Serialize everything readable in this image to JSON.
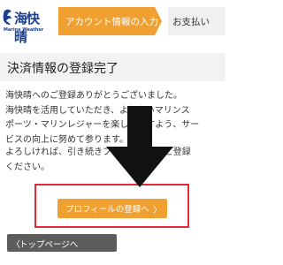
{
  "header": {
    "logo_text": "海快晴",
    "logo_sub": "Marine Weather",
    "steps": [
      {
        "label": "アカウント情報の入力",
        "state": "active"
      },
      {
        "label": "お支払い",
        "state": "inactive"
      }
    ]
  },
  "main": {
    "title": "決済情報の登録完了",
    "paragraph1_lines": [
      "海快晴へのご登録ありがとうございました。",
      "海快晴を活用していただき、よりよいマリンス",
      "ポーツ・マリンレジャーを楽しめますよう、サー",
      "ビスの向上に努めて参ります。"
    ],
    "paragraph2_lines": [
      "よろしければ、引き続きプロフィールをご登録",
      "ください。"
    ],
    "profile_button": "プロフィールの登録へ",
    "profile_button_chevron": "〉",
    "top_button": "トップページへ",
    "top_button_chevron": "〈"
  },
  "colors": {
    "accent_orange": "#f0a030",
    "highlight_red": "#e42a36",
    "logo_blue": "#1c3f8f",
    "dark_button": "#5c5c5c"
  },
  "icons": {
    "logo": "wave-logo-icon",
    "annotation": "down-arrow-icon"
  }
}
